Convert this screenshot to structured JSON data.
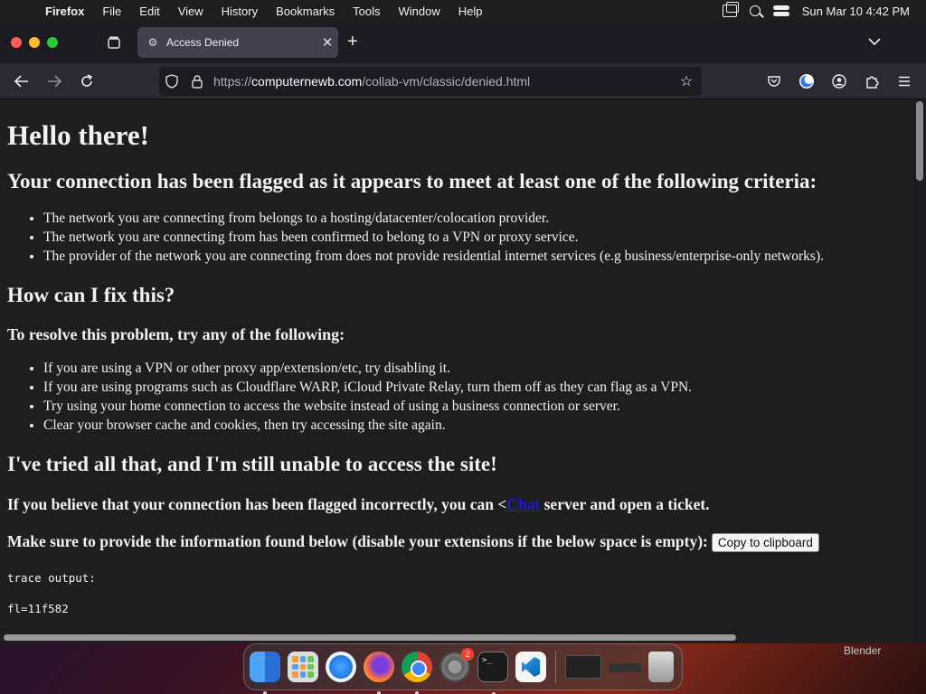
{
  "menubar": {
    "app_name": "Firefox",
    "items": [
      "File",
      "Edit",
      "View",
      "History",
      "Bookmarks",
      "Tools",
      "Window",
      "Help"
    ],
    "clock": "Sun Mar 10  4:42 PM"
  },
  "browser": {
    "tab_title": "Access Denied",
    "url_prefix": "https://",
    "url_domain": "computernewb.com",
    "url_path": "/collab-vm/classic/denied.html"
  },
  "page": {
    "heading": "Hello there!",
    "criteria_heading": "Your connection has been flagged as it appears to meet at least one of the following criteria:",
    "criteria": [
      "The network you are connecting from belongs to a hosting/datacenter/colocation provider.",
      "The network you are connecting from has been confirmed to belong to a VPN or proxy service.",
      "The provider of the network you are connecting from does not provide residential internet services (e.g business/enterprise-only networks)."
    ],
    "fix_heading": "How can I fix this?",
    "resolve_heading": "To resolve this problem, try any of the following:",
    "fixes": [
      "If you are using a VPN or other proxy app/extension/etc, try disabling it.",
      "If you are using programs such as Cloudflare WARP, iCloud Private Relay, turn them off as they can flag as a VPN.",
      "Try using your home connection to access the website instead of using a business connection or server.",
      "Clear your browser cache and cookies, then try accessing the site again."
    ],
    "still_heading": "I've tried all that, and I'm still unable to access the site!",
    "incorrect_prefix": "If you believe that your connection has been flagged incorrectly, you can <",
    "incorrect_link": "Chat",
    "incorrect_suffix": " server and open a ticket.",
    "info_text": "Make sure to provide the information found below (disable your extensions if the below space is empty):",
    "copy_button": "Copy to clipboard",
    "trace_title": "trace output:",
    "trace_line": "fl=11f582"
  },
  "desktop": {
    "blender_label": "Blender",
    "settings_badge": "2",
    "terminal_glyph": ">_"
  }
}
